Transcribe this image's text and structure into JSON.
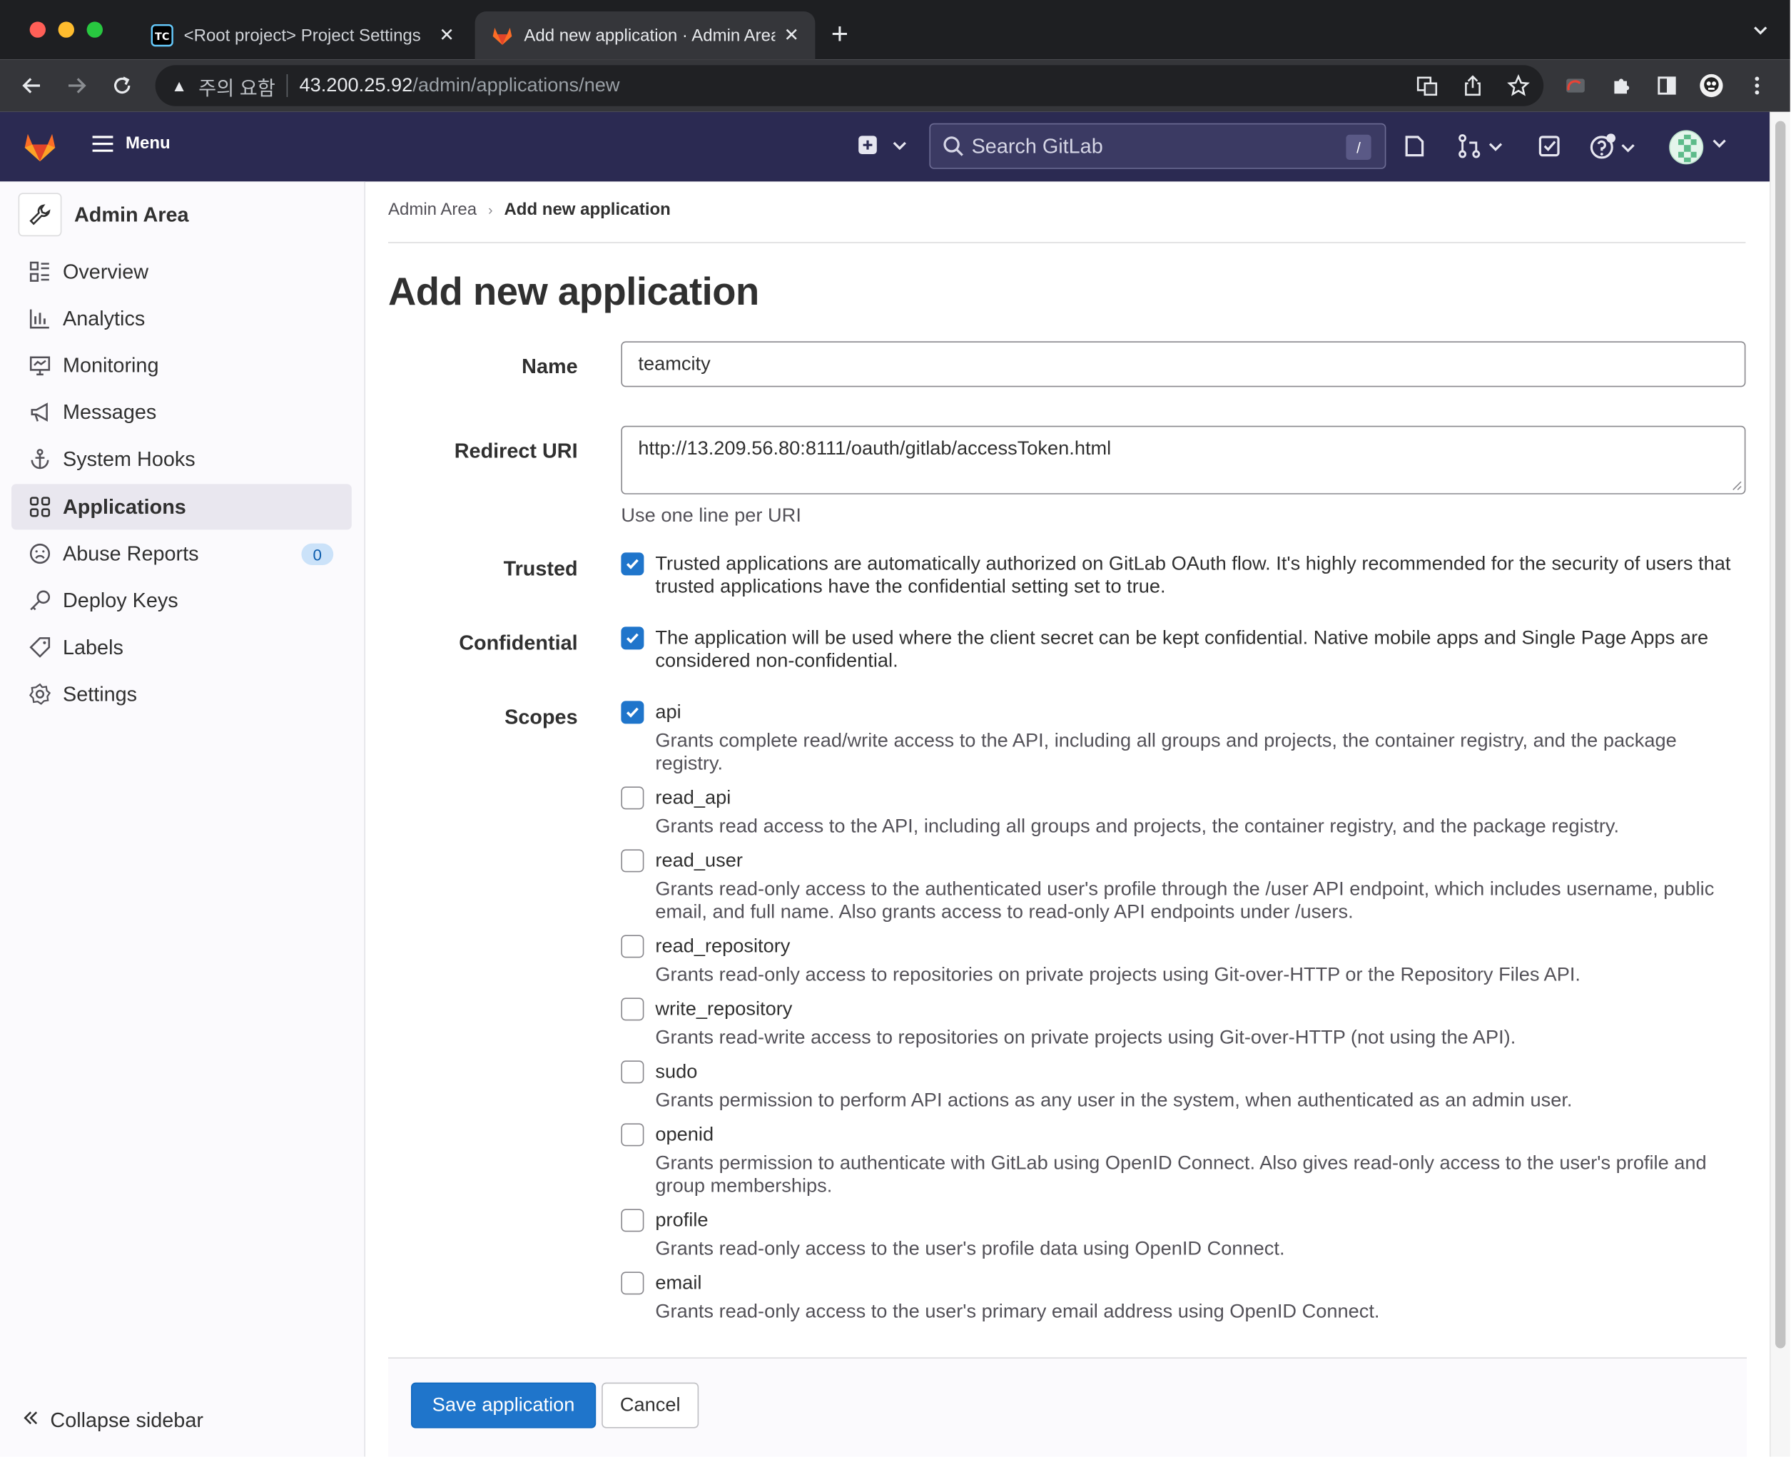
{
  "browser": {
    "tabs": [
      {
        "title": "<Root project> Project Settings",
        "active": false
      },
      {
        "title": "Add new application · Admin Area · GitLab",
        "active": true
      }
    ],
    "address": {
      "warning": "주의 요함",
      "host": "43.200.25.92",
      "path": "/admin/applications/new"
    }
  },
  "header": {
    "menu_label": "Menu",
    "search_placeholder": "Search GitLab",
    "search_shortcut": "/"
  },
  "sidebar": {
    "title": "Admin Area",
    "items": [
      {
        "label": "Overview",
        "icon": "overview-icon"
      },
      {
        "label": "Analytics",
        "icon": "chart-icon"
      },
      {
        "label": "Monitoring",
        "icon": "monitor-icon"
      },
      {
        "label": "Messages",
        "icon": "bullhorn-icon"
      },
      {
        "label": "System Hooks",
        "icon": "anchor-icon"
      },
      {
        "label": "Applications",
        "icon": "applications-icon",
        "active": true
      },
      {
        "label": "Abuse Reports",
        "icon": "abuse-icon",
        "badge": "0"
      },
      {
        "label": "Deploy Keys",
        "icon": "key-icon"
      },
      {
        "label": "Labels",
        "icon": "label-icon"
      },
      {
        "label": "Settings",
        "icon": "settings-icon"
      }
    ],
    "collapse_label": "Collapse sidebar"
  },
  "breadcrumb": {
    "parent": "Admin Area",
    "current": "Add new application"
  },
  "page_title": "Add new application",
  "form": {
    "name_label": "Name",
    "name_value": "teamcity",
    "redirect_label": "Redirect URI",
    "redirect_value": "http://13.209.56.80:8111/oauth/gitlab/accessToken.html",
    "redirect_help": "Use one line per URI",
    "trusted_label": "Trusted",
    "trusted_checked": true,
    "trusted_text": "Trusted applications are automatically authorized on GitLab OAuth flow. It's highly recommended for the security of users that trusted applications have the confidential setting set to true.",
    "confidential_label": "Confidential",
    "confidential_checked": true,
    "confidential_text": "The application will be used where the client secret can be kept confidential. Native mobile apps and Single Page Apps are considered non-confidential.",
    "scopes_label": "Scopes",
    "scopes": [
      {
        "name": "api",
        "checked": true,
        "desc": "Grants complete read/write access to the API, including all groups and projects, the container registry, and the package registry."
      },
      {
        "name": "read_api",
        "checked": false,
        "desc": "Grants read access to the API, including all groups and projects, the container registry, and the package registry."
      },
      {
        "name": "read_user",
        "checked": false,
        "desc": "Grants read-only access to the authenticated user's profile through the /user API endpoint, which includes username, public email, and full name. Also grants access to read-only API endpoints under /users."
      },
      {
        "name": "read_repository",
        "checked": false,
        "desc": "Grants read-only access to repositories on private projects using Git-over-HTTP or the Repository Files API."
      },
      {
        "name": "write_repository",
        "checked": false,
        "desc": "Grants read-write access to repositories on private projects using Git-over-HTTP (not using the API)."
      },
      {
        "name": "sudo",
        "checked": false,
        "desc": "Grants permission to perform API actions as any user in the system, when authenticated as an admin user."
      },
      {
        "name": "openid",
        "checked": false,
        "desc": "Grants permission to authenticate with GitLab using OpenID Connect. Also gives read-only access to the user's profile and group memberships."
      },
      {
        "name": "profile",
        "checked": false,
        "desc": "Grants read-only access to the user's profile data using OpenID Connect."
      },
      {
        "name": "email",
        "checked": false,
        "desc": "Grants read-only access to the user's primary email address using OpenID Connect."
      }
    ],
    "save_label": "Save application",
    "cancel_label": "Cancel"
  },
  "colors": {
    "header_bg": "#2b2a52",
    "primary": "#1f75cb",
    "sidebar_bg": "#fbfafd"
  }
}
